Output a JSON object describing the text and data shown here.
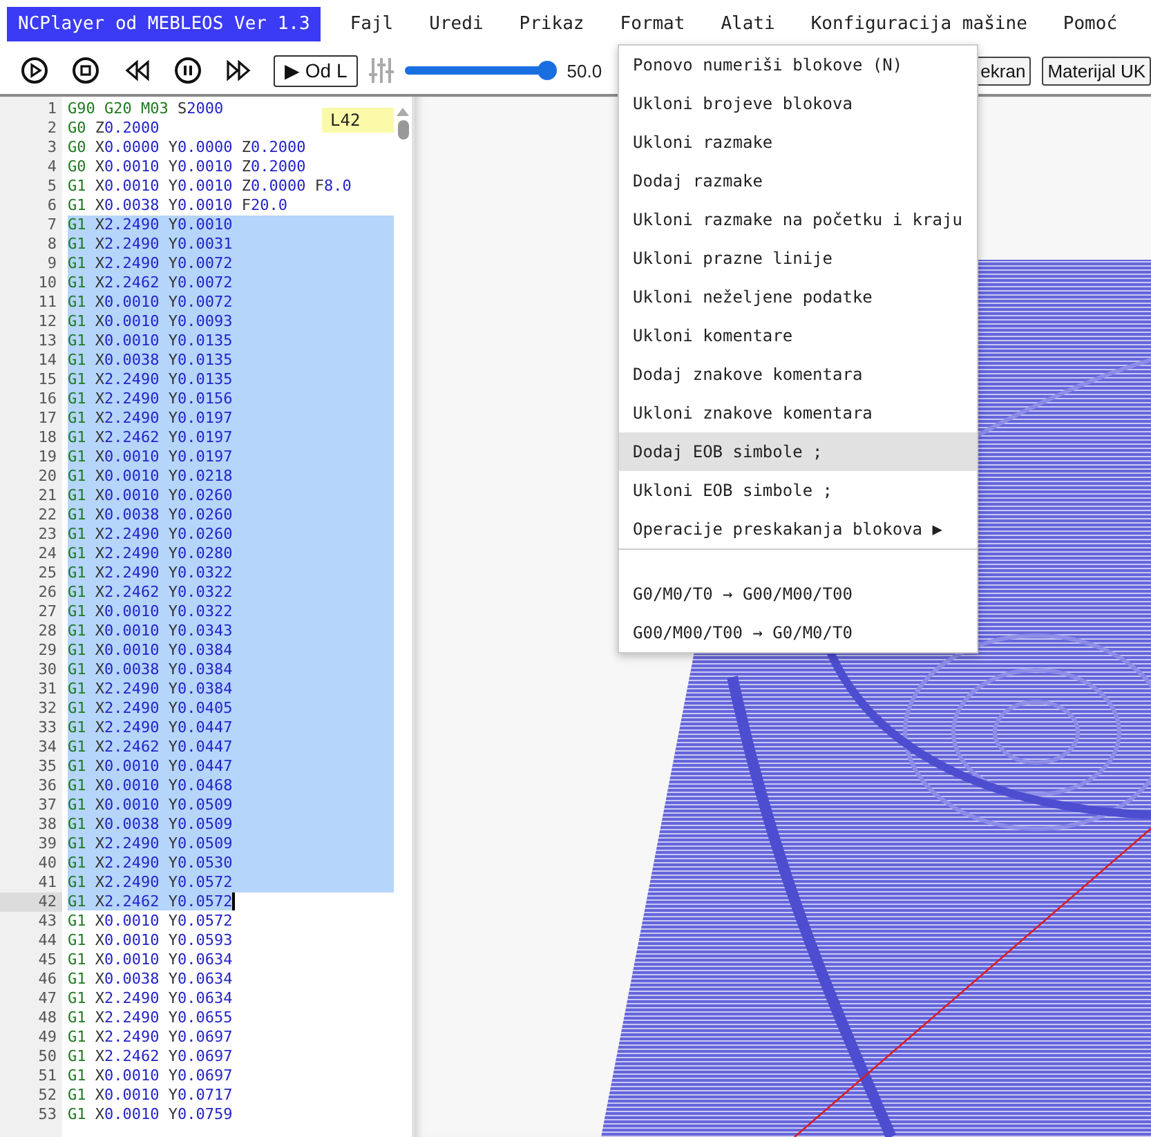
{
  "app_title": "NCPlayer od MEBLEOS Ver 1.3",
  "menu": [
    {
      "label": "Fajl"
    },
    {
      "label": "Uredi"
    },
    {
      "label": "Prikaz"
    },
    {
      "label": "Format"
    },
    {
      "label": "Alati"
    },
    {
      "label": "Konfiguracija mašine"
    },
    {
      "label": "Pomoć"
    }
  ],
  "toolbar": {
    "from_line_button": "▶ Od L",
    "speed_slider": {
      "level": 0.95
    },
    "speed_reading": "50.0",
    "buttons": [
      "ekran",
      "Materijal UK"
    ]
  },
  "editor": {
    "line_badge": "L42",
    "lines": [
      {
        "n": "1",
        "code": "G90 G20 M03 S2000",
        "selected": false,
        "current": false
      },
      {
        "n": "2",
        "code": "G0 Z0.2000",
        "selected": false,
        "current": false
      },
      {
        "n": "3",
        "code": "G0 X0.0000 Y0.0000 Z0.2000",
        "selected": false,
        "current": false
      },
      {
        "n": "4",
        "code": "G0 X0.0010 Y0.0010 Z0.2000",
        "selected": false,
        "current": false
      },
      {
        "n": "5",
        "code": "G1 X0.0010 Y0.0010 Z0.0000 F8.0",
        "selected": false,
        "current": false
      },
      {
        "n": "6",
        "code": "G1 X0.0038 Y0.0010 F20.0",
        "selected": false,
        "current": false
      },
      {
        "n": "7",
        "code": "G1 X2.2490 Y0.0010",
        "selected": true,
        "current": false
      },
      {
        "n": "8",
        "code": "G1 X2.2490 Y0.0031",
        "selected": true,
        "current": false
      },
      {
        "n": "9",
        "code": "G1 X2.2490 Y0.0072",
        "selected": true,
        "current": false
      },
      {
        "n": "10",
        "code": "G1 X2.2462 Y0.0072",
        "selected": true,
        "current": false
      },
      {
        "n": "11",
        "code": "G1 X0.0010 Y0.0072",
        "selected": true,
        "current": false
      },
      {
        "n": "12",
        "code": "G1 X0.0010 Y0.0093",
        "selected": true,
        "current": false
      },
      {
        "n": "13",
        "code": "G1 X0.0010 Y0.0135",
        "selected": true,
        "current": false
      },
      {
        "n": "14",
        "code": "G1 X0.0038 Y0.0135",
        "selected": true,
        "current": false
      },
      {
        "n": "15",
        "code": "G1 X2.2490 Y0.0135",
        "selected": true,
        "current": false
      },
      {
        "n": "16",
        "code": "G1 X2.2490 Y0.0156",
        "selected": true,
        "current": false
      },
      {
        "n": "17",
        "code": "G1 X2.2490 Y0.0197",
        "selected": true,
        "current": false
      },
      {
        "n": "18",
        "code": "G1 X2.2462 Y0.0197",
        "selected": true,
        "current": false
      },
      {
        "n": "19",
        "code": "G1 X0.0010 Y0.0197",
        "selected": true,
        "current": false
      },
      {
        "n": "20",
        "code": "G1 X0.0010 Y0.0218",
        "selected": true,
        "current": false
      },
      {
        "n": "21",
        "code": "G1 X0.0010 Y0.0260",
        "selected": true,
        "current": false
      },
      {
        "n": "22",
        "code": "G1 X0.0038 Y0.0260",
        "selected": true,
        "current": false
      },
      {
        "n": "23",
        "code": "G1 X2.2490 Y0.0260",
        "selected": true,
        "current": false
      },
      {
        "n": "24",
        "code": "G1 X2.2490 Y0.0280",
        "selected": true,
        "current": false
      },
      {
        "n": "25",
        "code": "G1 X2.2490 Y0.0322",
        "selected": true,
        "current": false
      },
      {
        "n": "26",
        "code": "G1 X2.2462 Y0.0322",
        "selected": true,
        "current": false
      },
      {
        "n": "27",
        "code": "G1 X0.0010 Y0.0322",
        "selected": true,
        "current": false
      },
      {
        "n": "28",
        "code": "G1 X0.0010 Y0.0343",
        "selected": true,
        "current": false
      },
      {
        "n": "29",
        "code": "G1 X0.0010 Y0.0384",
        "selected": true,
        "current": false
      },
      {
        "n": "30",
        "code": "G1 X0.0038 Y0.0384",
        "selected": true,
        "current": false
      },
      {
        "n": "31",
        "code": "G1 X2.2490 Y0.0384",
        "selected": true,
        "current": false
      },
      {
        "n": "32",
        "code": "G1 X2.2490 Y0.0405",
        "selected": true,
        "current": false
      },
      {
        "n": "33",
        "code": "G1 X2.2490 Y0.0447",
        "selected": true,
        "current": false
      },
      {
        "n": "34",
        "code": "G1 X2.2462 Y0.0447",
        "selected": true,
        "current": false
      },
      {
        "n": "35",
        "code": "G1 X0.0010 Y0.0447",
        "selected": true,
        "current": false
      },
      {
        "n": "36",
        "code": "G1 X0.0010 Y0.0468",
        "selected": true,
        "current": false
      },
      {
        "n": "37",
        "code": "G1 X0.0010 Y0.0509",
        "selected": true,
        "current": false
      },
      {
        "n": "38",
        "code": "G1 X0.0038 Y0.0509",
        "selected": true,
        "current": false
      },
      {
        "n": "39",
        "code": "G1 X2.2490 Y0.0509",
        "selected": true,
        "current": false
      },
      {
        "n": "40",
        "code": "G1 X2.2490 Y0.0530",
        "selected": true,
        "current": false
      },
      {
        "n": "41",
        "code": "G1 X2.2490 Y0.0572",
        "selected": true,
        "current": false
      },
      {
        "n": "42",
        "code": "G1 X2.2462 Y0.0572",
        "selected": true,
        "current": true
      },
      {
        "n": "43",
        "code": "G1 X0.0010 Y0.0572",
        "selected": false,
        "current": false
      },
      {
        "n": "44",
        "code": "G1 X0.0010 Y0.0593",
        "selected": false,
        "current": false
      },
      {
        "n": "45",
        "code": "G1 X0.0010 Y0.0634",
        "selected": false,
        "current": false
      },
      {
        "n": "46",
        "code": "G1 X0.0038 Y0.0634",
        "selected": false,
        "current": false
      },
      {
        "n": "47",
        "code": "G1 X2.2490 Y0.0634",
        "selected": false,
        "current": false
      },
      {
        "n": "48",
        "code": "G1 X2.2490 Y0.0655",
        "selected": false,
        "current": false
      },
      {
        "n": "49",
        "code": "G1 X2.2490 Y0.0697",
        "selected": false,
        "current": false
      },
      {
        "n": "50",
        "code": "G1 X2.2462 Y0.0697",
        "selected": false,
        "current": false
      },
      {
        "n": "51",
        "code": "G1 X0.0010 Y0.0697",
        "selected": false,
        "current": false
      },
      {
        "n": "52",
        "code": "G1 X0.0010 Y0.0717",
        "selected": false,
        "current": false
      },
      {
        "n": "53",
        "code": "G1 X0.0010 Y0.0759",
        "selected": false,
        "current": false
      }
    ]
  },
  "format_menu": [
    {
      "kind": "item",
      "label": "Ponovo numeriši blokove (N)",
      "selected": false
    },
    {
      "kind": "item",
      "label": "Ukloni brojeve blokova",
      "selected": false
    },
    {
      "kind": "item",
      "label": "Ukloni razmake",
      "selected": false
    },
    {
      "kind": "item",
      "label": "Dodaj razmake",
      "selected": false
    },
    {
      "kind": "item",
      "label": "Ukloni razmake na početku i kraju",
      "selected": false
    },
    {
      "kind": "item",
      "label": "Ukloni prazne linije",
      "selected": false
    },
    {
      "kind": "item",
      "label": "Ukloni neželjene podatke",
      "selected": false
    },
    {
      "kind": "item",
      "label": "Ukloni komentare",
      "selected": false
    },
    {
      "kind": "item",
      "label": "Dodaj znakove komentara",
      "selected": false
    },
    {
      "kind": "item",
      "label": "Ukloni znakove komentara",
      "selected": false
    },
    {
      "kind": "item",
      "label": "Dodaj EOB simbole ;",
      "selected": true
    },
    {
      "kind": "item",
      "label": "Ukloni EOB simbole ;",
      "selected": false
    },
    {
      "kind": "submenu",
      "label": "Operacije preskakanja blokova",
      "arrow": "▶",
      "selected": false
    },
    {
      "kind": "separator"
    },
    {
      "kind": "item",
      "label": "G0/M0/T0 → G00/M00/T00",
      "selected": false
    },
    {
      "kind": "item",
      "label": "G00/M00/T00 → G0/M0/T0",
      "selected": false
    }
  ]
}
